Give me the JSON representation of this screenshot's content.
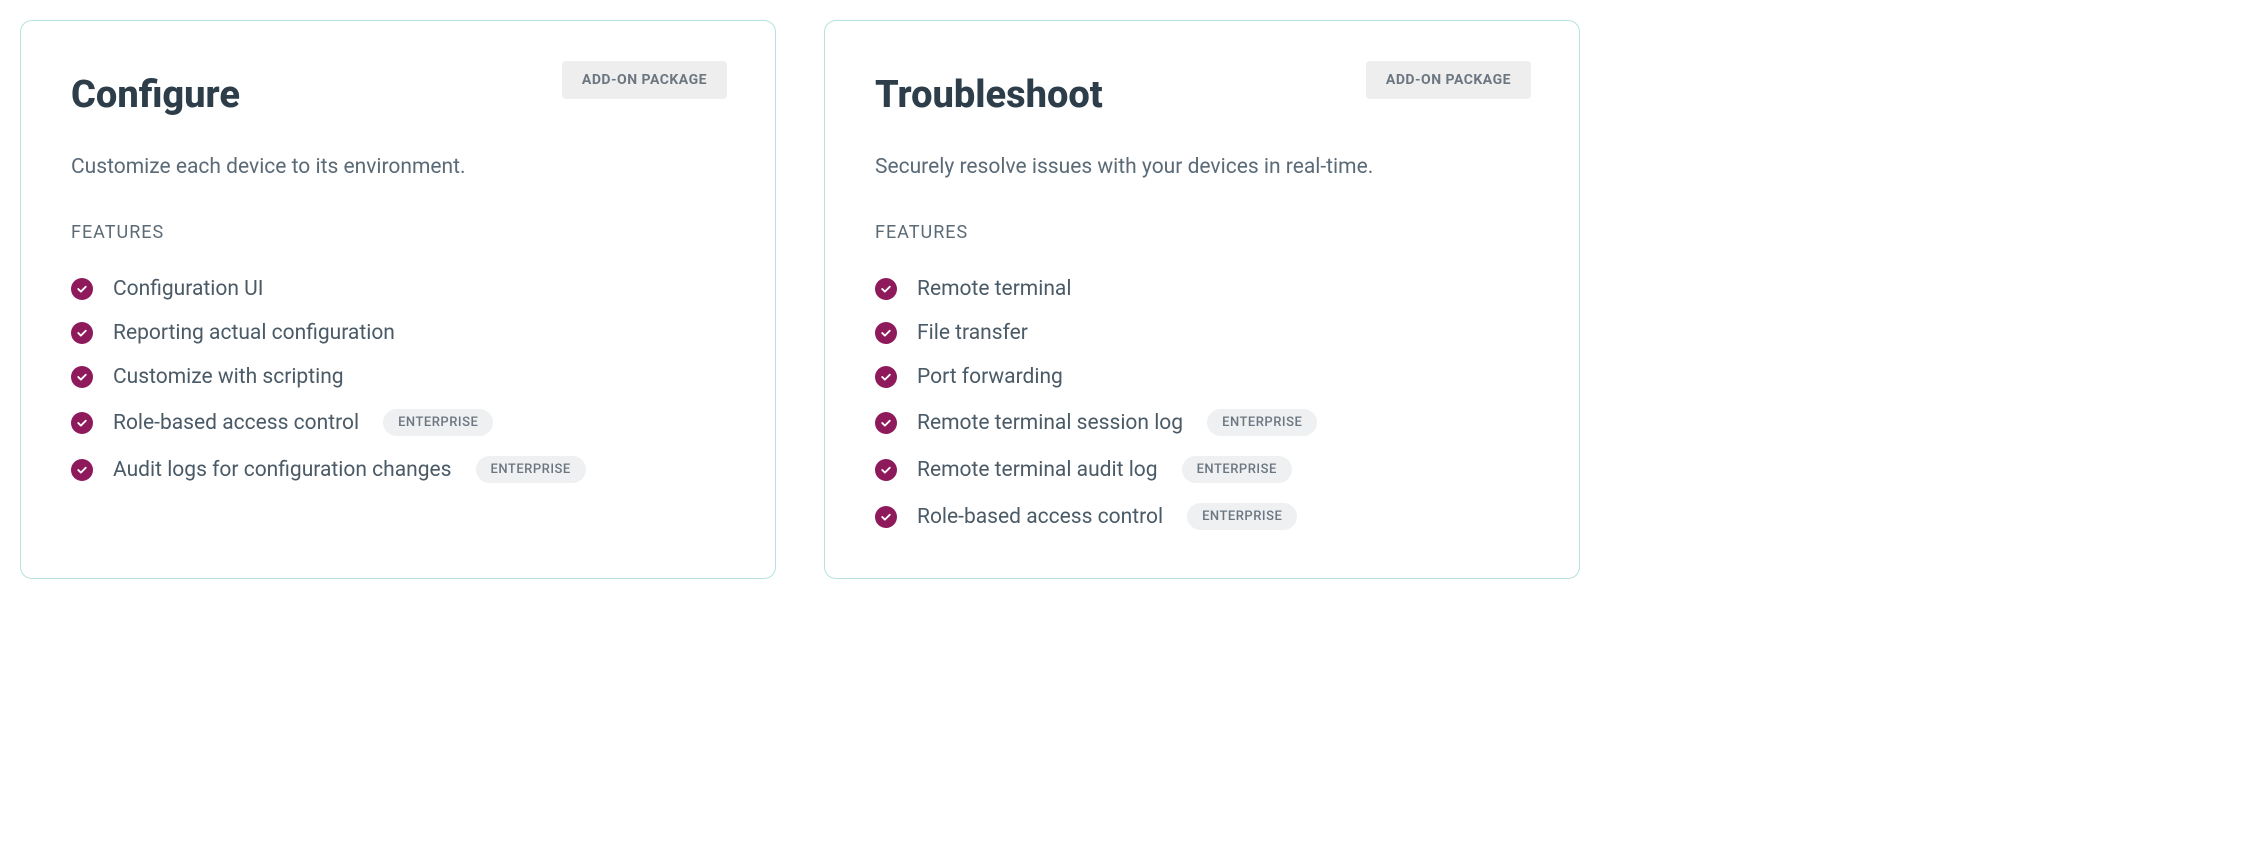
{
  "common": {
    "addon_label": "ADD-ON PACKAGE",
    "features_heading": "FEATURES",
    "enterprise_label": "ENTERPRISE"
  },
  "cards": [
    {
      "title": "Configure",
      "description": "Customize each device to its environment.",
      "features": [
        {
          "label": "Configuration UI",
          "enterprise": false
        },
        {
          "label": "Reporting actual configuration",
          "enterprise": false
        },
        {
          "label": "Customize with scripting",
          "enterprise": false
        },
        {
          "label": "Role-based access control",
          "enterprise": true
        },
        {
          "label": "Audit logs for configuration changes",
          "enterprise": true
        }
      ]
    },
    {
      "title": "Troubleshoot",
      "description": "Securely resolve issues with your devices in real-time.",
      "features": [
        {
          "label": "Remote terminal",
          "enterprise": false
        },
        {
          "label": "File transfer",
          "enterprise": false
        },
        {
          "label": "Port forwarding",
          "enterprise": false
        },
        {
          "label": "Remote terminal session log",
          "enterprise": true
        },
        {
          "label": "Remote terminal audit log",
          "enterprise": true
        },
        {
          "label": "Role-based access control",
          "enterprise": true
        }
      ]
    }
  ]
}
